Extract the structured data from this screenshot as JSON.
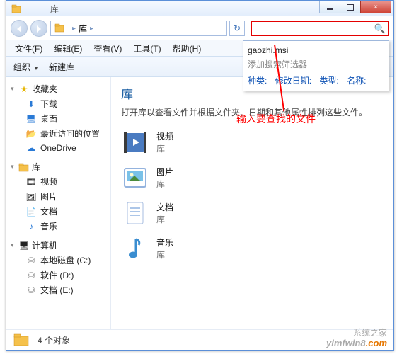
{
  "title": {
    "icon_label": "E",
    "text": "库"
  },
  "win_buttons": {
    "min": "min",
    "max": "max",
    "close": "×"
  },
  "address": {
    "crumb1": "库",
    "arrow": "▸",
    "refresh": "↻"
  },
  "search": {
    "placeholder": ""
  },
  "suggest": {
    "typed": "gaozhi.msi",
    "hint": "添加搜索筛选器",
    "filters_label": "种类:",
    "filter_date": "修改日期:",
    "filter_type": "类型:",
    "filter_name": "名称:"
  },
  "annotation": {
    "text": "输入要查找的文件"
  },
  "menu": {
    "file": "文件(F)",
    "edit": "编辑(E)",
    "view": "查看(V)",
    "tools": "工具(T)",
    "help": "帮助(H)"
  },
  "toolbar": {
    "organize": "组织",
    "newlib": "新建库"
  },
  "sidebar": {
    "favorites": {
      "label": "收藏夹",
      "items": [
        "下载",
        "桌面",
        "最近访问的位置",
        "OneDrive"
      ]
    },
    "libraries": {
      "label": "库",
      "items": [
        "视频",
        "图片",
        "文档",
        "音乐"
      ]
    },
    "computer": {
      "label": "计算机",
      "items": [
        "本地磁盘 (C:)",
        "软件 (D:)",
        "文档 (E:)"
      ]
    }
  },
  "content": {
    "heading": "库",
    "desc": "打开库以查看文件并根据文件夹、日期和其他属性排列这些文件。",
    "items": [
      {
        "name": "视频",
        "sub": "库"
      },
      {
        "name": "图片",
        "sub": "库"
      },
      {
        "name": "文档",
        "sub": "库"
      },
      {
        "name": "音乐",
        "sub": "库"
      }
    ]
  },
  "status": {
    "count": "4 个对象"
  },
  "watermark1": "系统之家",
  "watermark2a": "ylmfwin8",
  "watermark2b": ".com"
}
